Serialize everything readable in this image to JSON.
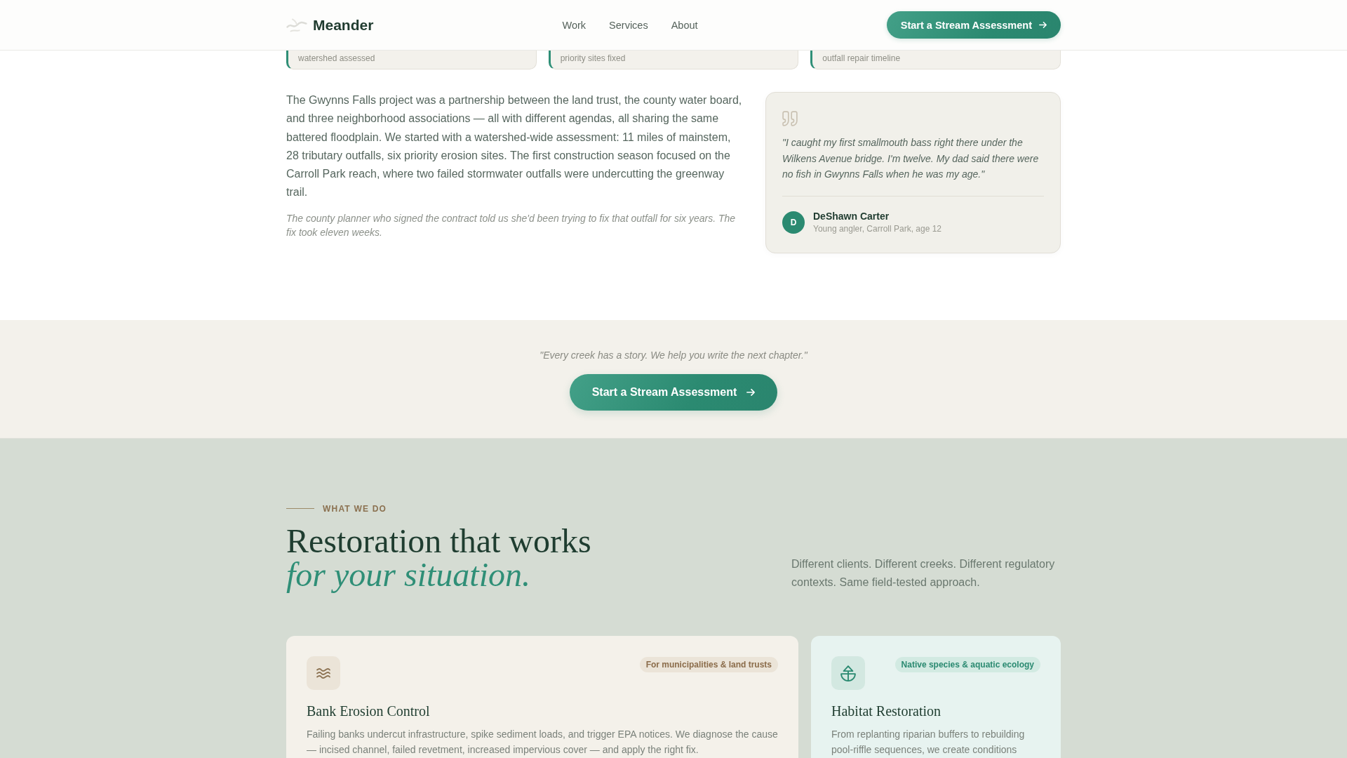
{
  "header": {
    "brand": "Meander",
    "nav": [
      {
        "label": "Work"
      },
      {
        "label": "Services"
      },
      {
        "label": "About"
      }
    ],
    "cta": "Start a Stream Assessment"
  },
  "stats": [
    {
      "label": "watershed assessed"
    },
    {
      "label": "priority sites fixed"
    },
    {
      "label": "outfall repair timeline"
    }
  ],
  "story": {
    "body": "The Gwynns Falls project was a partnership between the land trust, the county water board, and three neighborhood associations — all with different agendas, all sharing the same battered floodplain. We started with a watershed-wide assessment: 11 miles of mainstem, 28 tributary outfalls, six priority erosion sites. The first construction season focused on the Carroll Park reach, where two failed stormwater outfalls were undercutting the greenway trail.",
    "note": "The county planner who signed the contract told us she'd been trying to fix that outfall for six years. The fix took eleven weeks."
  },
  "testimonial": {
    "quote": "\"I caught my first smallmouth bass right there under the Wilkens Avenue bridge. I'm twelve. My dad said there were no fish in Gwynns Falls when he was my age.\"",
    "initial": "D",
    "author": "DeShawn Carter",
    "role": "Young angler, Carroll Park, age 12"
  },
  "cta_band": {
    "tagline": "\"Every creek has a story. We help you write the next chapter.\"",
    "button": "Start a Stream Assessment"
  },
  "services": {
    "eyebrow": "WHAT WE DO",
    "title": "Restoration that works *for your situation.*",
    "intro": "Different clients. Different creeks. Different regulatory contexts. Same field-tested approach.",
    "cards": [
      {
        "kind": "earth",
        "tag": "For municipalities & land trusts",
        "title": "Bank Erosion Control",
        "description": "Failing banks undercut infrastructure, spike sediment loads, and trigger EPA notices. We diagnose the cause — incised channel, failed revetment, increased impervious cover — and apply the right fix."
      },
      {
        "kind": "water",
        "tag": "Native species & aquatic ecology",
        "title": "Habitat Restoration",
        "description": "From replanting riparian buffers to rebuilding pool-riffle sequences, we create conditions"
      }
    ]
  }
}
